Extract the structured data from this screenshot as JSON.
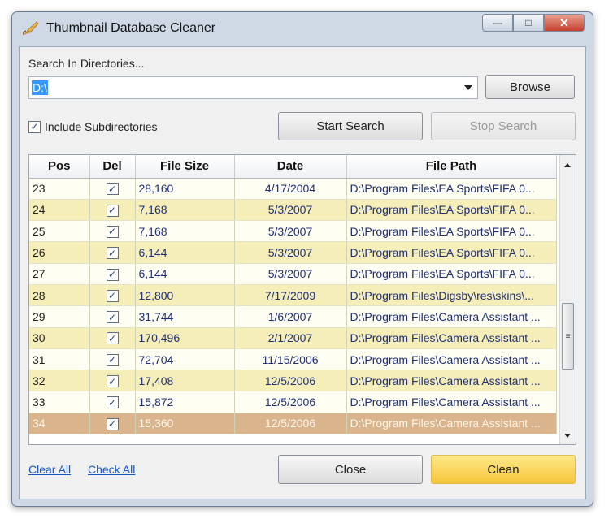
{
  "window": {
    "title": "Thumbnail Database Cleaner",
    "min_glyph": "—",
    "max_glyph": "□",
    "close_glyph": "✕"
  },
  "search": {
    "label": "Search In Directories...",
    "value": "D:\\",
    "browse_label": "Browse"
  },
  "options": {
    "include_subdirectories_label": "Include Subdirectories",
    "include_subdirectories_checked": true
  },
  "actions": {
    "start_search": "Start Search",
    "stop_search": "Stop Search",
    "close": "Close",
    "clean": "Clean",
    "clear_all": "Clear All",
    "check_all": "Check All"
  },
  "table": {
    "columns": [
      "Pos",
      "Del",
      "File Size",
      "Date",
      "File Path"
    ],
    "rows": [
      {
        "pos": "23",
        "del": true,
        "size": "28,160",
        "date": "4/17/2004",
        "path": "D:\\Program Files\\EA Sports\\FIFA 0..."
      },
      {
        "pos": "24",
        "del": true,
        "size": "7,168",
        "date": "5/3/2007",
        "path": "D:\\Program Files\\EA Sports\\FIFA 0..."
      },
      {
        "pos": "25",
        "del": true,
        "size": "7,168",
        "date": "5/3/2007",
        "path": "D:\\Program Files\\EA Sports\\FIFA 0..."
      },
      {
        "pos": "26",
        "del": true,
        "size": "6,144",
        "date": "5/3/2007",
        "path": "D:\\Program Files\\EA Sports\\FIFA 0..."
      },
      {
        "pos": "27",
        "del": true,
        "size": "6,144",
        "date": "5/3/2007",
        "path": "D:\\Program Files\\EA Sports\\FIFA 0..."
      },
      {
        "pos": "28",
        "del": true,
        "size": "12,800",
        "date": "7/17/2009",
        "path": "D:\\Program Files\\Digsby\\res\\skins\\..."
      },
      {
        "pos": "29",
        "del": true,
        "size": "31,744",
        "date": "1/6/2007",
        "path": "D:\\Program Files\\Camera Assistant ..."
      },
      {
        "pos": "30",
        "del": true,
        "size": "170,496",
        "date": "2/1/2007",
        "path": "D:\\Program Files\\Camera Assistant ..."
      },
      {
        "pos": "31",
        "del": true,
        "size": "72,704",
        "date": "11/15/2006",
        "path": "D:\\Program Files\\Camera Assistant ..."
      },
      {
        "pos": "32",
        "del": true,
        "size": "17,408",
        "date": "12/5/2006",
        "path": "D:\\Program Files\\Camera Assistant ..."
      },
      {
        "pos": "33",
        "del": true,
        "size": "15,872",
        "date": "12/5/2006",
        "path": "D:\\Program Files\\Camera Assistant ..."
      },
      {
        "pos": "34",
        "del": true,
        "size": "15,360",
        "date": "12/5/2006",
        "path": "D:\\Program Files\\Camera Assistant ...",
        "selected": true
      }
    ],
    "scroll_grip_glyph": "≡"
  },
  "colors": {
    "row_odd": "#fffef2",
    "row_even": "#f6eeb8",
    "row_selected": "#d9b48c",
    "link": "#1a55c8",
    "clean_button": "#f6c53a"
  },
  "icons": {
    "app": "paint-brush-icon",
    "scroll_up": "arrow-up-icon",
    "scroll_down": "arrow-down-icon",
    "combo": "chevron-down-icon"
  }
}
